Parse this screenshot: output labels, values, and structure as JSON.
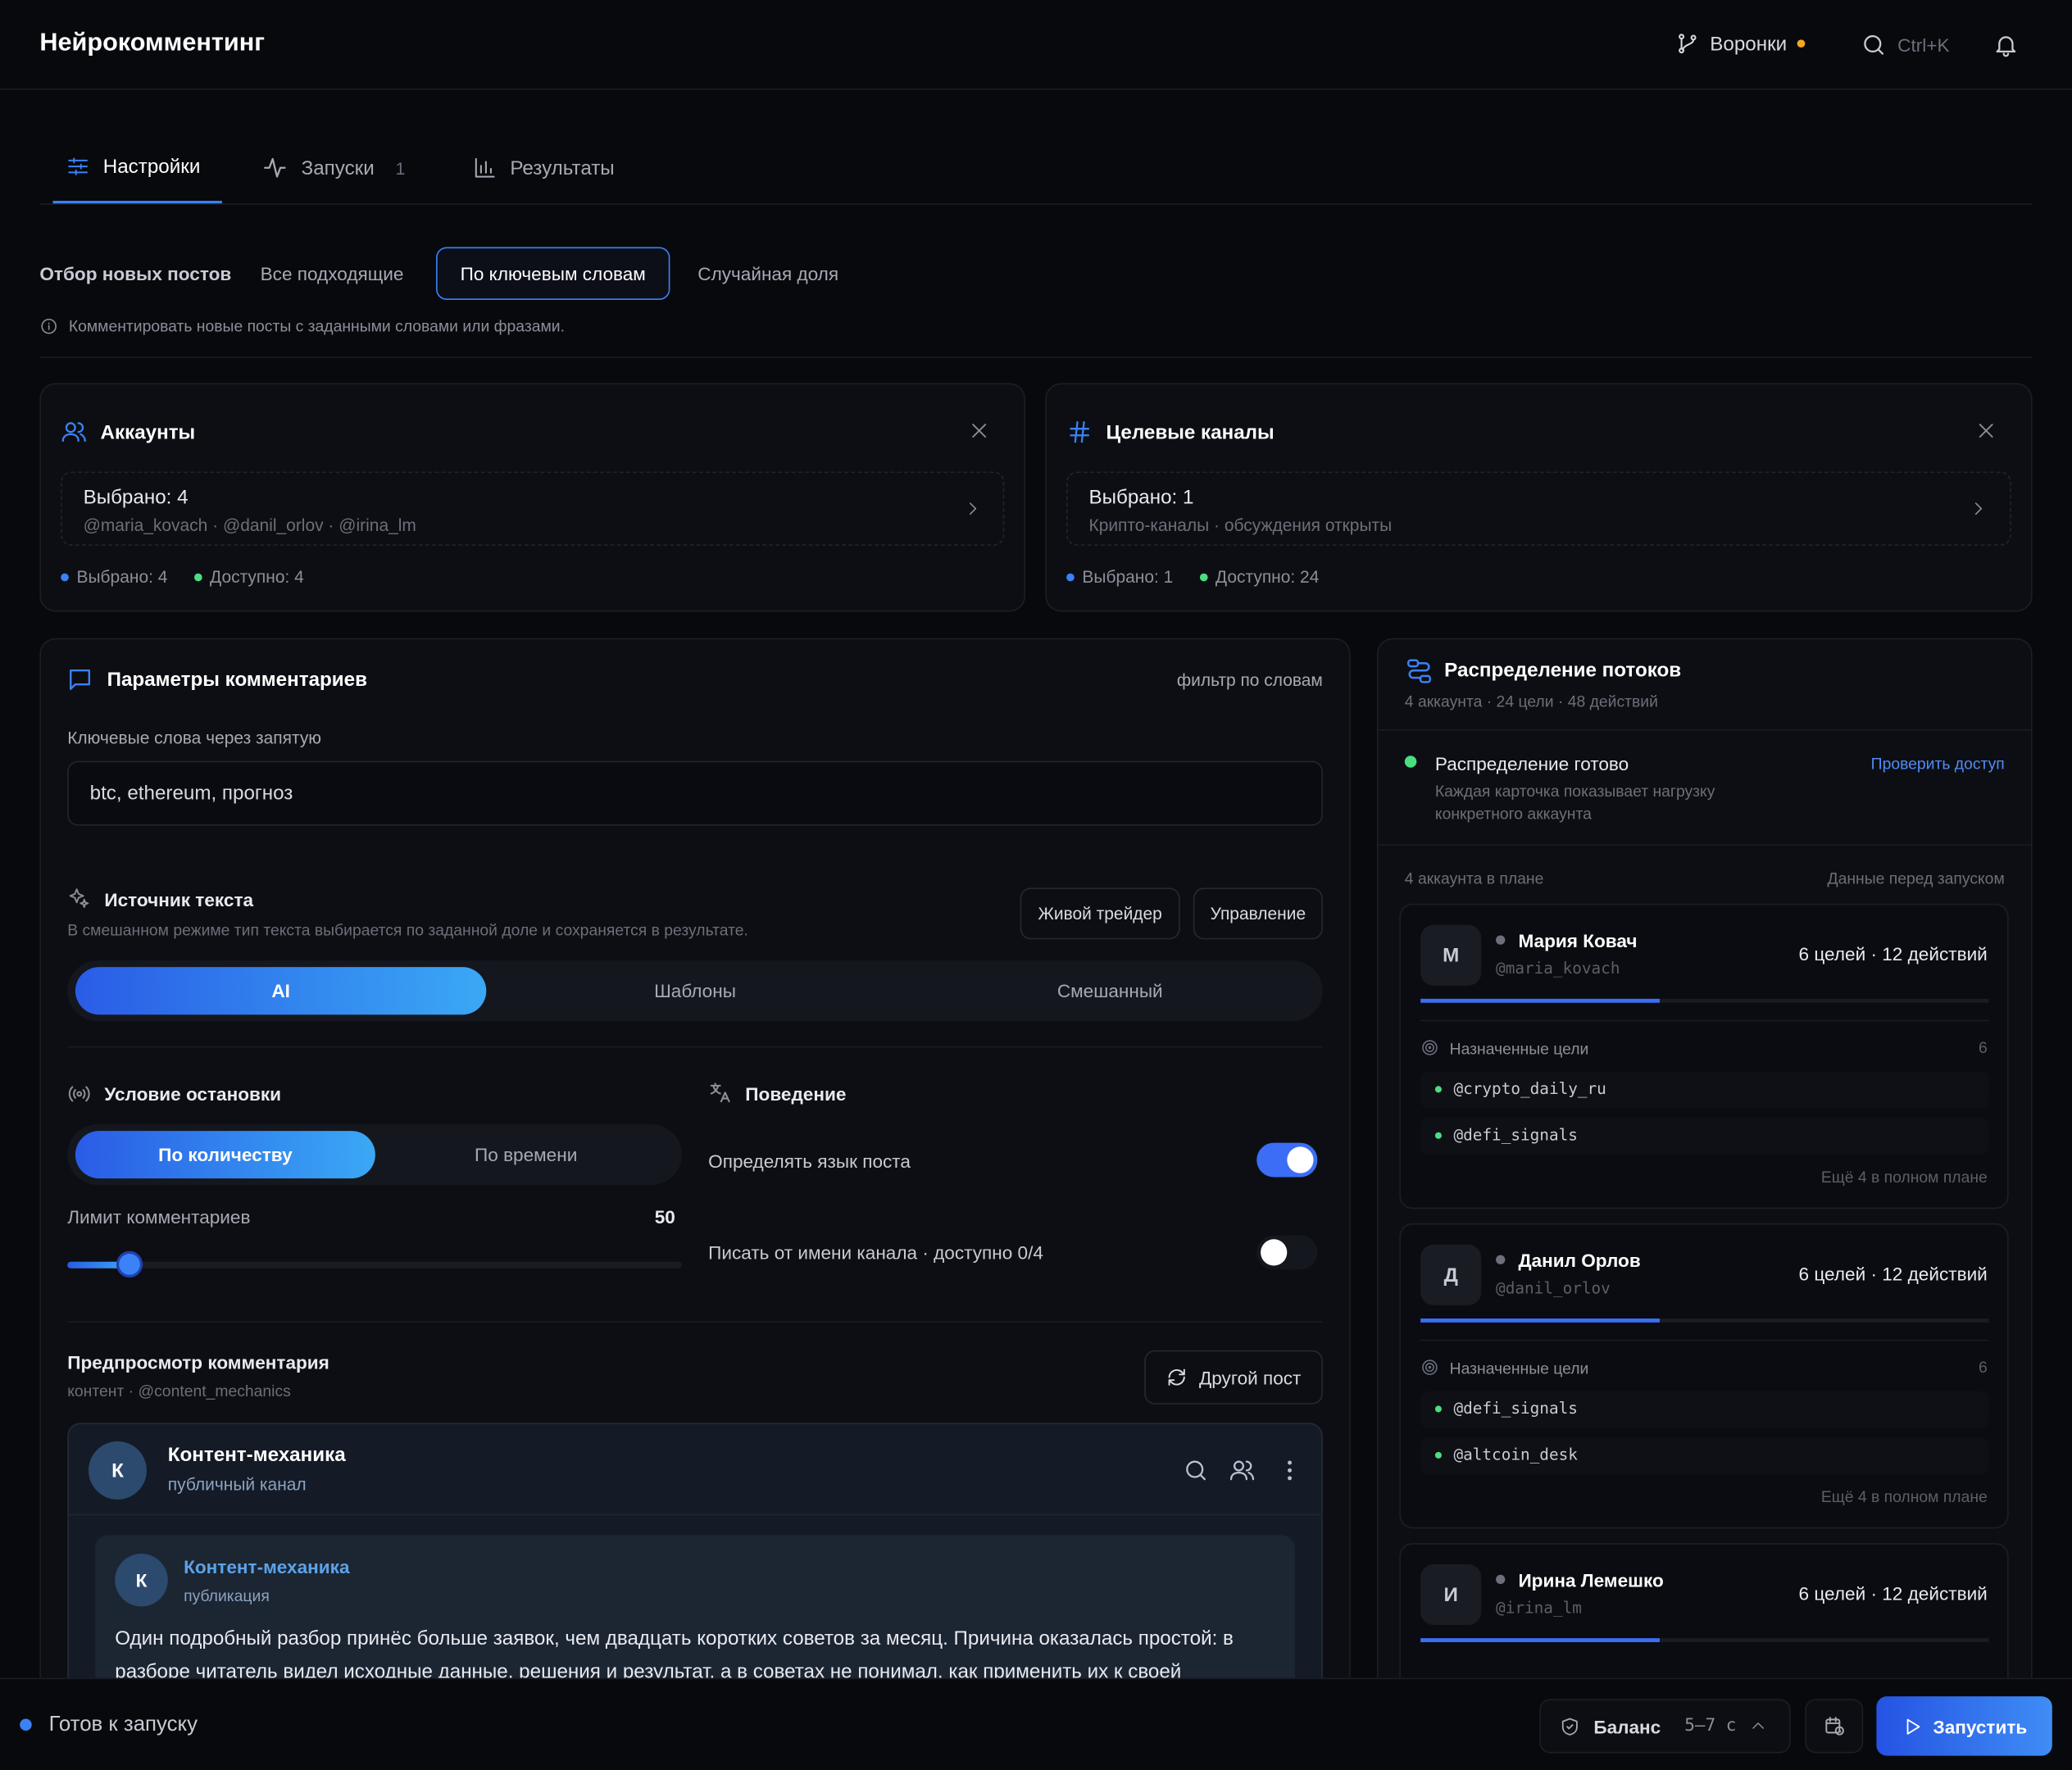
{
  "app": {
    "title": "Нейрокомментинг"
  },
  "header": {
    "funnels_label": "Воронки",
    "search_shortcut": "Ctrl+K"
  },
  "tabs": [
    {
      "label": "Настройки"
    },
    {
      "label": "Запуски",
      "badge": "1"
    },
    {
      "label": "Результаты"
    }
  ],
  "selection": {
    "label": "Отбор новых постов",
    "options": [
      "Все подходящие",
      "По ключевым словам",
      "Случайная доля"
    ],
    "active": "По ключевым словам",
    "hint": "Комментировать новые посты с заданными словами или фразами."
  },
  "accounts": {
    "title": "Аккаунты",
    "selected_title": "Выбрано: 4",
    "selected_sub": "@maria_kovach · @danil_orlov · @irina_lm",
    "stat_selected": "Выбрано: 4",
    "stat_available": "Доступно: 4"
  },
  "channels": {
    "title": "Целевые каналы",
    "selected_title": "Выбрано: 1",
    "selected_sub": "Крипто-каналы · обсуждения открыты",
    "stat_selected": "Выбрано: 1",
    "stat_available": "Доступно: 24"
  },
  "params": {
    "title": "Параметры комментариев",
    "mode_label": "фильтр по словам",
    "keywords_label": "Ключевые слова через запятую",
    "keywords_value": "btc, ethereum, прогноз",
    "source_title": "Источник текста",
    "source_hint": "В смешанном режиме тип текста выбирается по заданной доле и сохраняется в результате.",
    "preset_1": "Живой трейдер",
    "preset_2": "Управление",
    "source_options": [
      "AI",
      "Шаблоны",
      "Смешанный"
    ],
    "stop_title": "Условие остановки",
    "stop_options": [
      "По количеству",
      "По времени"
    ],
    "limit_label": "Лимит комментариев",
    "limit_value": "50",
    "limit_fraction": 0.1,
    "behavior_title": "Поведение",
    "detect_lang_label": "Определять язык поста",
    "detect_lang_on": true,
    "as_channel_label": "Писать от имени канала · доступно 0/4",
    "as_channel_on": false
  },
  "preview": {
    "title": "Предпросмотр комментария",
    "subtitle": "контент · @content_mechanics",
    "other_post_label": "Другой пост",
    "channel_initial": "К",
    "channel_name": "Контент-механика",
    "channel_type": "публичный канал",
    "post_author": "Контент-механика",
    "post_kind": "публикация",
    "post_text": "Один подробный разбор принёс больше заявок, чем двадцать коротких советов за месяц. Причина оказалась простой: в разборе читатель видел исходные данные, решения и результат, а в советах не понимал, как применить их к своей"
  },
  "distribution": {
    "title": "Распределение потоков",
    "subtitle": "4 аккаунта · 24 цели · 48 действий",
    "status_title": "Распределение готово",
    "status_sub": "Каждая карточка показывает нагрузку конкретного аккаунта",
    "check_access": "Проверить доступ",
    "plan_label": "4 аккаунта в плане",
    "plan_right": "Данные перед запуском",
    "accounts": [
      {
        "initial": "М",
        "name": "Мария Ковач",
        "handle": "@maria_kovach",
        "stats": "6 целей · 12 действий",
        "load": 0.42,
        "targets_label": "Назначенные цели",
        "targets_count": "6",
        "targets": [
          "@crypto_daily_ru",
          "@defi_signals"
        ],
        "more": "Ещё 4 в полном плане"
      },
      {
        "initial": "Д",
        "name": "Данил Орлов",
        "handle": "@danil_orlov",
        "stats": "6 целей · 12 действий",
        "load": 0.42,
        "targets_label": "Назначенные цели",
        "targets_count": "6",
        "targets": [
          "@defi_signals",
          "@altcoin_desk"
        ],
        "more": "Ещё 4 в полном плане"
      },
      {
        "initial": "И",
        "name": "Ирина Лемешко",
        "handle": "@irina_lm",
        "stats": "6 целей · 12 действий",
        "load": 0.42
      }
    ]
  },
  "footer": {
    "status": "Готов к запуску",
    "balance_label": "Баланс",
    "balance_value": "5–7 с",
    "launch_label": "Запустить"
  },
  "colors": {
    "accent": "#3b82f6",
    "green": "#4ade80",
    "orange": "#f5a524",
    "bg": "#08090d"
  }
}
